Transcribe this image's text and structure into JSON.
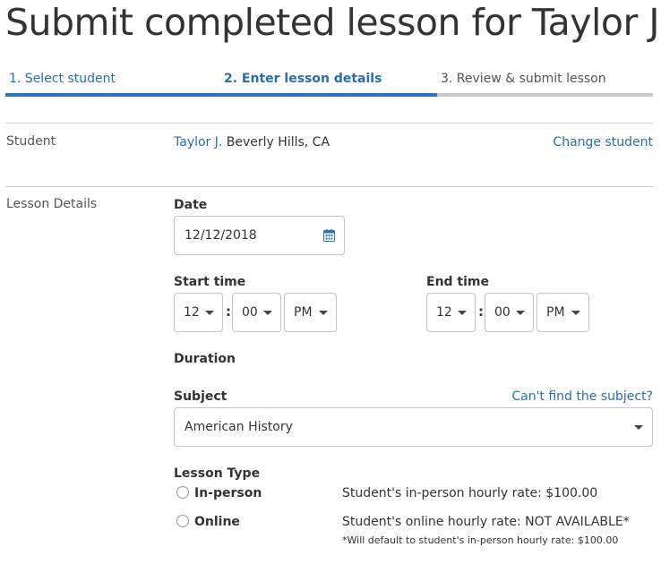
{
  "page": {
    "title": "Submit completed lesson for Taylor J."
  },
  "steps": [
    {
      "label": "1. Select student",
      "state": "complete"
    },
    {
      "label": "2. Enter lesson details",
      "state": "active"
    },
    {
      "label": "3. Review & submit lesson",
      "state": "pending"
    }
  ],
  "student": {
    "row_label": "Student",
    "name": "Taylor J.",
    "location": " Beverly Hills, CA",
    "change_label": "Change student"
  },
  "lesson": {
    "row_label": "Lesson Details",
    "date_label": "Date",
    "date_value": "12/12/2018",
    "date_icon": "calendar-icon",
    "start_label": "Start time",
    "start": {
      "hour": "12",
      "minute": "00",
      "ampm": "PM"
    },
    "end_label": "End time",
    "end": {
      "hour": "12",
      "minute": "00",
      "ampm": "PM"
    },
    "time_separator": ":",
    "duration_label": "Duration",
    "subject_label": "Subject",
    "cant_find_label": "Can't find the subject?",
    "subject_value": "American History",
    "lesson_type_label": "Lesson Type",
    "types": [
      {
        "label": "In-person",
        "rate": "Student's in-person hourly rate: $100.00",
        "selected": false
      },
      {
        "label": "Online",
        "rate": "Student's online hourly rate: NOT AVAILABLE*",
        "selected": false
      }
    ],
    "online_note": "*Will default to student's in-person hourly rate: $100.00"
  },
  "colors": {
    "accent": "#2b73c2",
    "link": "#2b6cb0",
    "inactive_bar": "#c8c8c8"
  }
}
